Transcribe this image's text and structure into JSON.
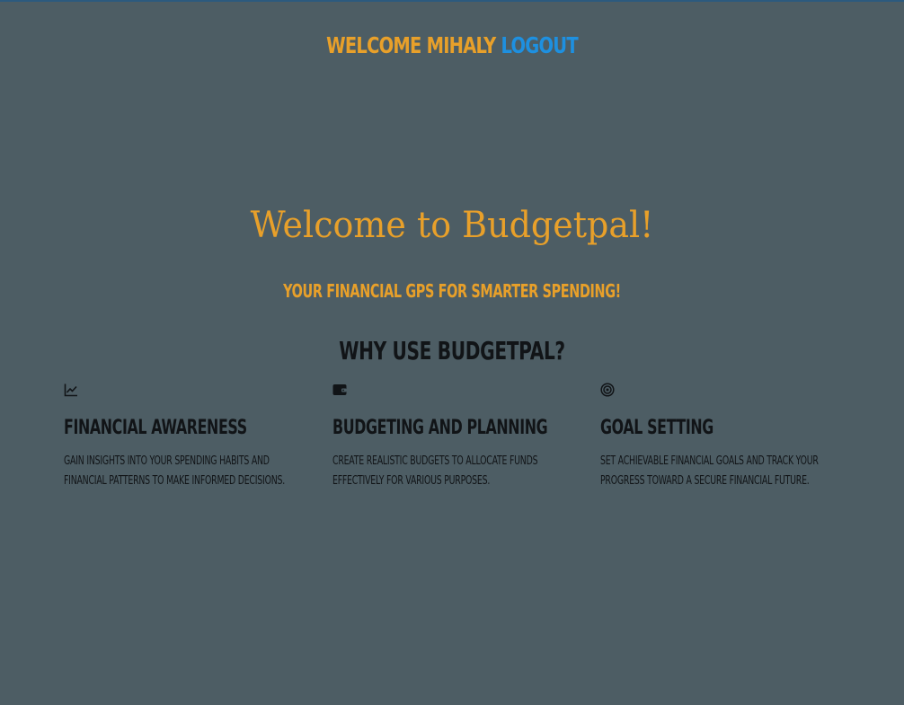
{
  "header": {
    "welcome_text": "WELCOME MIHALY",
    "logout_label": "LOGOUT"
  },
  "hero": {
    "title": "Welcome to Budgetpal!",
    "tagline": "YOUR FINANCIAL GPS FOR SMARTER SPENDING!"
  },
  "features_section": {
    "heading": "WHY USE BUDGETPAL?",
    "items": [
      {
        "icon": "line-chart-icon",
        "title": "FINANCIAL AWARENESS",
        "description": "GAIN INSIGHTS INTO YOUR SPENDING HABITS AND FINANCIAL PATTERNS TO MAKE INFORMED DECISIONS."
      },
      {
        "icon": "wallet-icon",
        "title": "BUDGETING AND PLANNING",
        "description": "CREATE REALISTIC BUDGETS TO ALLOCATE FUNDS EFFECTIVELY FOR VARIOUS PURPOSES."
      },
      {
        "icon": "target-icon",
        "title": "GOAL SETTING",
        "description": "SET ACHIEVABLE FINANCIAL GOALS AND TRACK YOUR PROGRESS TOWARD A SECURE FINANCIAL FUTURE."
      }
    ]
  },
  "colors": {
    "background": "#4d5d64",
    "accent": "#e8a02a",
    "link": "#1e90e0",
    "text_dark": "#111417"
  }
}
